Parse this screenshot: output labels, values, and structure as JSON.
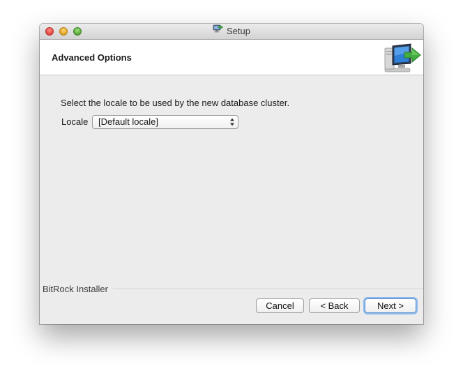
{
  "window": {
    "title": "Setup",
    "title_icon": "installer-app-icon"
  },
  "header": {
    "title": "Advanced Options",
    "icon": "computer-install-arrow-icon"
  },
  "content": {
    "instruction": "Select the locale to be used by the new database cluster.",
    "locale_label": "Locale",
    "locale_select": {
      "selected": "[Default locale]"
    }
  },
  "footer": {
    "brand": "BitRock Installer",
    "buttons": {
      "cancel": "Cancel",
      "back": "< Back",
      "next": "Next >"
    }
  },
  "colors": {
    "window_bg": "#ececec",
    "header_bg": "#ffffff",
    "default_button_focus": "#8db9ec",
    "close": "#e0443e",
    "minimize": "#dea123",
    "zoom": "#56a33a"
  }
}
